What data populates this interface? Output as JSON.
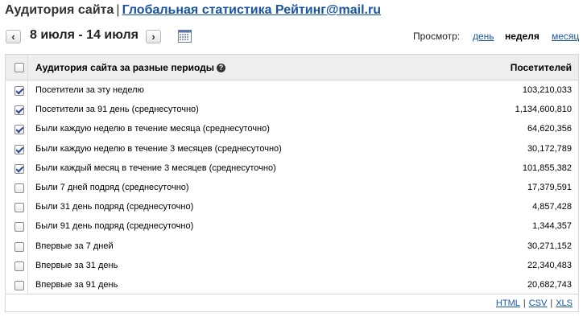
{
  "header": {
    "title": "Аудитория сайта",
    "separator": "|",
    "link": "Глобальная статистика Рейтинг@mail.ru"
  },
  "date_nav": {
    "prev_label": "‹",
    "range": "8 июля - 14 июля",
    "next_label": "›",
    "calendar_icon": "calendar-icon"
  },
  "view": {
    "label": "Просмотр:",
    "day": "день",
    "week": "неделя",
    "month": "месяц",
    "selected": "неделя"
  },
  "table": {
    "header_label": "Аудитория сайта за разные периоды",
    "help_icon": "?",
    "visitors_label": "Посетителей",
    "rows": [
      {
        "label": "Посетители за эту неделю",
        "value": "103,210,033",
        "checked": true
      },
      {
        "label": "Посетители за 91 день (среднесуточно)",
        "value": "1,134,600,810",
        "checked": true
      },
      {
        "label": "Были каждую неделю в течение месяца (среднесуточно)",
        "value": "64,620,356",
        "checked": true
      },
      {
        "label": "Были каждую неделю в течение 3 месяцев (среднесуточно)",
        "value": "30,172,789",
        "checked": true
      },
      {
        "label": "Были каждый месяц в течение 3 месяцев (среднесуточно)",
        "value": "101,855,382",
        "checked": true
      },
      {
        "label": "Были 7 дней подряд (среднесуточно)",
        "value": "17,379,591",
        "checked": false
      },
      {
        "label": "Были 31 день подряд (среднесуточно)",
        "value": "4,857,428",
        "checked": false
      },
      {
        "label": "Были 91 день подряд (среднесуточно)",
        "value": "1,344,357",
        "checked": false
      },
      {
        "label": "Впервые за 7 дней",
        "value": "30,271,152",
        "checked": false
      },
      {
        "label": "Впервые за 31 день",
        "value": "22,340,483",
        "checked": false
      },
      {
        "label": "Впервые за 91 день",
        "value": "20,682,743",
        "checked": false
      }
    ]
  },
  "export": {
    "html": "HTML",
    "csv": "CSV",
    "xls": "XLS",
    "separator": "|"
  },
  "colors": {
    "link": "#1a55a3",
    "header_bg": "#eeeeee",
    "border": "#d6d6d6"
  }
}
